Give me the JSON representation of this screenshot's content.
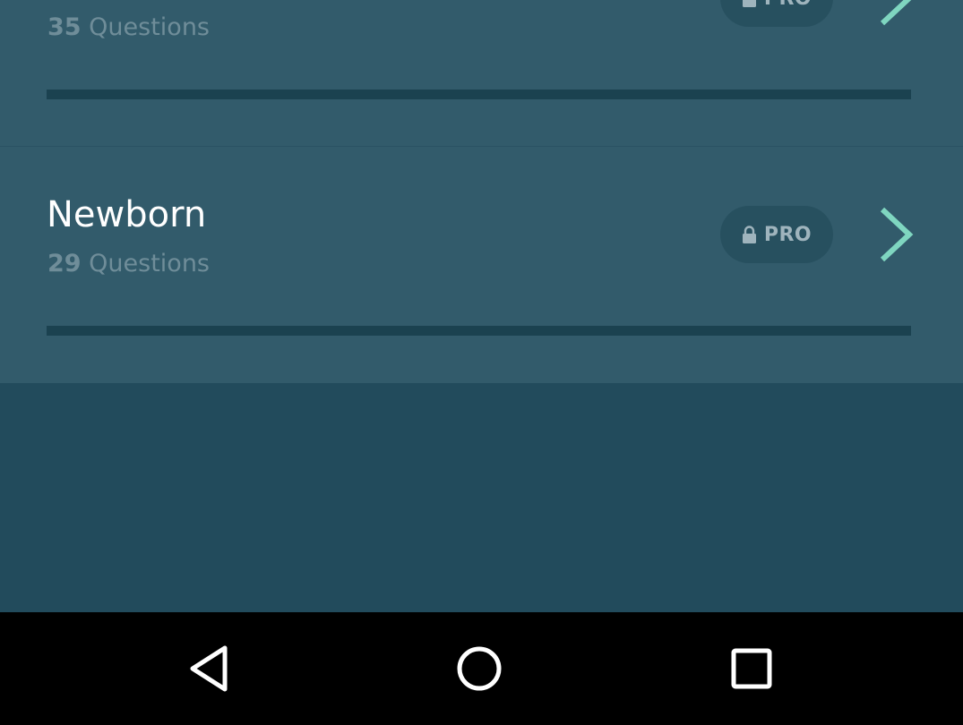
{
  "topics": [
    {
      "title": "",
      "question_count": "35",
      "question_label": "Questions",
      "pro_label": "PRO",
      "progress": 0
    },
    {
      "title": "Newborn",
      "question_count": "29",
      "question_label": "Questions",
      "pro_label": "PRO",
      "progress": 0
    }
  ],
  "icons": {
    "lock": "lock-icon",
    "chevron": "chevron-right-icon",
    "back": "back-triangle-icon",
    "home": "home-circle-icon",
    "recents": "recents-square-icon"
  },
  "colors": {
    "list_background": "#325b6b",
    "page_background": "#224b5c",
    "progress_track": "#1b4250",
    "chevron": "#7fd6c0",
    "navbar": "#000000"
  }
}
